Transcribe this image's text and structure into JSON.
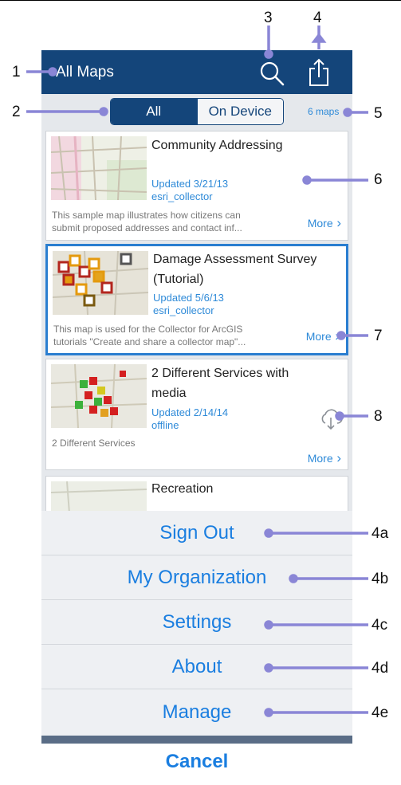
{
  "nav": {
    "title": "All Maps"
  },
  "segment": {
    "all": "All",
    "on_device": "On Device"
  },
  "map_count": "6 maps",
  "maps": [
    {
      "title_line1": "Community Addressing",
      "title_line2": "",
      "updated": "Updated 3/21/13",
      "owner": "esri_collector",
      "desc_line1": "This sample map illustrates how citizens can",
      "desc_line2": "submit proposed addresses and contact inf...",
      "more": "More"
    },
    {
      "title_line1": "Damage Assessment Survey",
      "title_line2": "(Tutorial)",
      "updated": "Updated 5/6/13",
      "owner": "esri_collector",
      "desc_line1": "This map is used for the Collector for ArcGIS",
      "desc_line2": "tutorials \"Create and share a collector map\"...",
      "more": "More"
    },
    {
      "title_line1": "2 Different Services with",
      "title_line2": "media",
      "updated": "Updated 2/14/14",
      "owner": "offline",
      "desc_line1": "2 Different Services",
      "desc_line2": "",
      "more": "More"
    },
    {
      "title_line1": "Recreation"
    }
  ],
  "action_sheet": {
    "items": [
      "Sign Out",
      "My Organization",
      "Settings",
      "About",
      "Manage"
    ],
    "cancel": "Cancel"
  },
  "callouts": {
    "c1": "1",
    "c2": "2",
    "c3": "3",
    "c4": "4",
    "c5": "5",
    "c6": "6",
    "c7": "7",
    "c8": "8",
    "c4a": "4a",
    "c4b": "4b",
    "c4c": "4c",
    "c4d": "4d",
    "c4e": "4e"
  },
  "colors": {
    "navbar": "#14457a",
    "link": "#2e8ad8",
    "callout_line": "#8a86d6",
    "selected_border": "#2a7ed0"
  }
}
